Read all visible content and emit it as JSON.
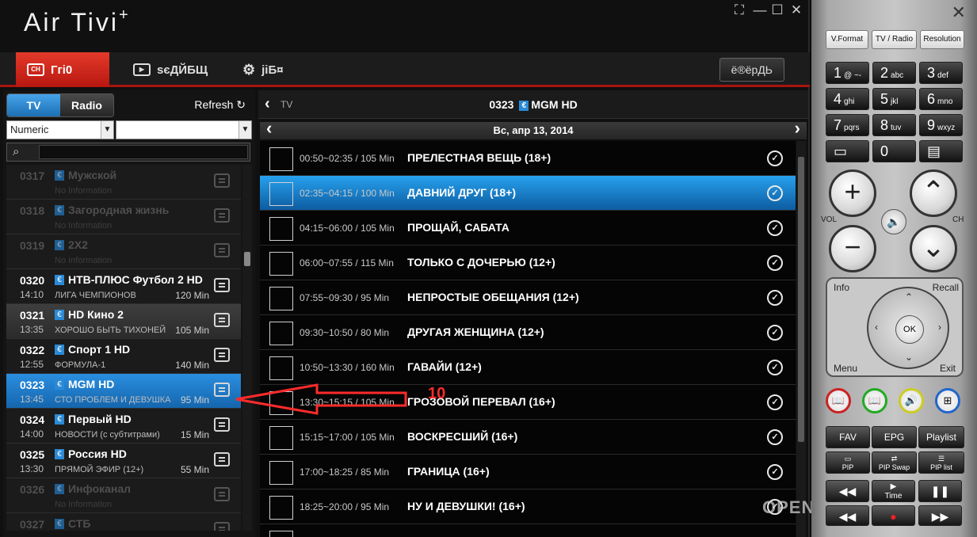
{
  "app": {
    "title": "Air Tivi",
    "title_sup": "+",
    "tab_tv": "Ггі0",
    "tab_rec": "ѕєДЙБЩ",
    "tab_settings": "јіБ¤",
    "top_button": "ё®ёрДЬ"
  },
  "left": {
    "tab_tv": "TV",
    "tab_radio": "Radio",
    "refresh": "Refresh",
    "sort_select": "Numeric",
    "search_placeholder": ""
  },
  "channels": [
    {
      "num": "0317",
      "name": "Мужской",
      "sub": "No Information",
      "time": "",
      "dur": "",
      "state": "dim"
    },
    {
      "num": "0318",
      "name": "Загородная жизнь",
      "sub": "No Information",
      "time": "",
      "dur": "",
      "state": "dim"
    },
    {
      "num": "0319",
      "name": "2Х2",
      "sub": "No Information",
      "time": "",
      "dur": "",
      "state": "dim"
    },
    {
      "num": "0320",
      "name": "НТВ-ПЛЮС Футбол 2 HD",
      "sub": "ЛИГА ЧЕМПИОНОВ",
      "time": "14:10",
      "dur": "120 Min",
      "state": "normal"
    },
    {
      "num": "0321",
      "name": "HD Кино 2",
      "sub": "ХОРОШО БЫТЬ ТИХОНЕЙ",
      "time": "13:35",
      "dur": "105 Min",
      "state": "sel"
    },
    {
      "num": "0322",
      "name": "Спорт 1 HD",
      "sub": "ФОРМУЛА-1",
      "time": "12:55",
      "dur": "140 Min",
      "state": "normal"
    },
    {
      "num": "0323",
      "name": "MGM HD",
      "sub": "СТО ПРОБЛЕМ И ДЕВУШКА",
      "time": "13:45",
      "dur": "95 Min",
      "state": "blue"
    },
    {
      "num": "0324",
      "name": "Первый HD",
      "sub": "НОВОСТИ (с субтитрами)",
      "time": "14:00",
      "dur": "15 Min",
      "state": "normal"
    },
    {
      "num": "0325",
      "name": "Россия HD",
      "sub": "ПРЯМОЙ ЭФИР (12+)",
      "time": "13:30",
      "dur": "55 Min",
      "state": "normal"
    },
    {
      "num": "0326",
      "name": "Инфоканал",
      "sub": "No Information",
      "time": "",
      "dur": "",
      "state": "dim"
    },
    {
      "num": "0327",
      "name": "СТБ",
      "sub": "",
      "time": "",
      "dur": "",
      "state": "dim"
    }
  ],
  "epg_header": {
    "back_label": "TV",
    "channel_num": "0323",
    "channel_name": "MGM HD",
    "date": "Вс, апр 13, 2014"
  },
  "events": [
    {
      "range": "00:50~02:35 / 105 Min",
      "title": "ПРЕЛЕСТНАЯ ВЕЩЬ (18+)",
      "highlight": false
    },
    {
      "range": "02:35~04:15 / 100 Min",
      "title": "ДАВНИЙ ДРУГ (18+)",
      "highlight": true
    },
    {
      "range": "04:15~06:00 / 105 Min",
      "title": "ПРОЩАЙ, САБАТА",
      "highlight": false
    },
    {
      "range": "06:00~07:55 / 115 Min",
      "title": "ТОЛЬКО С ДОЧЕРЬЮ (12+)",
      "highlight": false
    },
    {
      "range": "07:55~09:30 / 95 Min",
      "title": "НЕПРОСТЫЕ ОБЕЩАНИЯ (12+)",
      "highlight": false
    },
    {
      "range": "09:30~10:50 / 80 Min",
      "title": "ДРУГАЯ ЖЕНЩИНА (12+)",
      "highlight": false
    },
    {
      "range": "10:50~13:30 / 160 Min",
      "title": "ГАВАЙИ (12+)",
      "highlight": false
    },
    {
      "range": "13:30~15:15 / 105 Min",
      "title": "ГРОЗОВОЙ ПЕРЕВАЛ (16+)",
      "highlight": false
    },
    {
      "range": "15:15~17:00 / 105 Min",
      "title": "ВОСКРЕСШИЙ (16+)",
      "highlight": false
    },
    {
      "range": "17:00~18:25 / 85 Min",
      "title": "ГРАНИЦА (16+)",
      "highlight": false
    },
    {
      "range": "18:25~20:00 / 95 Min",
      "title": "НУ И ДЕВУШКИ! (16+)",
      "highlight": false
    },
    {
      "range": "",
      "title": "",
      "highlight": false
    }
  ],
  "annotation": {
    "label": "10",
    "color": "#ff2b2b"
  },
  "watermark": "OPENBOXFAN.COM",
  "remote": {
    "top_buttons": [
      "V.Format",
      "TV / Radio",
      "Resolution"
    ],
    "keys": [
      {
        "d": "1",
        "s": "@ ~-"
      },
      {
        "d": "2",
        "s": "abc"
      },
      {
        "d": "3",
        "s": "def"
      },
      {
        "d": "4",
        "s": "ghi"
      },
      {
        "d": "5",
        "s": "jkl"
      },
      {
        "d": "6",
        "s": "mno"
      },
      {
        "d": "7",
        "s": "pqrs"
      },
      {
        "d": "8",
        "s": "tuv"
      },
      {
        "d": "9",
        "s": "wxyz"
      },
      {
        "d": "▭",
        "s": ""
      },
      {
        "d": "0",
        "s": ""
      },
      {
        "d": "▤",
        "s": ""
      }
    ],
    "vol_label": "VOL",
    "ch_label": "CH",
    "info_label": "Info",
    "recall_label": "Recall",
    "menu_label": "Menu",
    "exit_label": "Exit",
    "ok_label": "OK",
    "fav": "FAV",
    "epg": "EPG",
    "playlist": "Playlist",
    "pip": "PIP",
    "pip_swap": "PIP Swap",
    "pip_list": "PIP list",
    "time_label": "Time"
  },
  "colors": {
    "accent_red": "#c41a12",
    "accent_blue": "#1f7fcf"
  }
}
